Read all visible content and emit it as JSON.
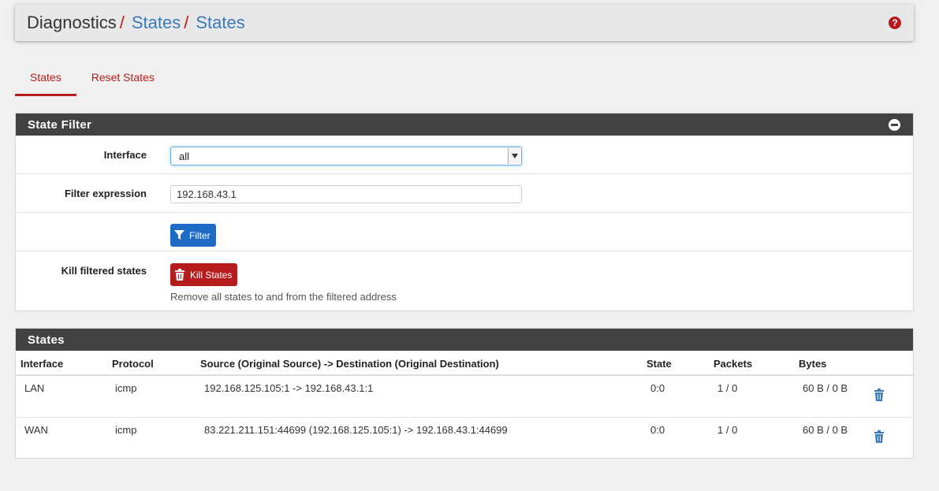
{
  "breadcrumb": {
    "root": "Diagnostics",
    "separator": "/",
    "items": [
      "States",
      "States"
    ]
  },
  "help_icon": "?",
  "tabs": [
    {
      "label": "States",
      "active": true
    },
    {
      "label": "Reset States",
      "active": false
    }
  ],
  "state_filter": {
    "title": "State Filter",
    "interface_label": "Interface",
    "interface_value": "all",
    "filter_expression_label": "Filter expression",
    "filter_expression_value": "192.168.43.1",
    "filter_button": "Filter",
    "kill_label": "Kill filtered states",
    "kill_button": "Kill States",
    "kill_help": "Remove all states to and from the filtered address"
  },
  "states": {
    "title": "States",
    "columns": [
      "Interface",
      "Protocol",
      "Source (Original Source) -> Destination (Original Destination)",
      "State",
      "Packets",
      "Bytes"
    ],
    "rows": [
      {
        "interface": "LAN",
        "protocol": "icmp",
        "source_dest": "192.168.125.105:1 -> 192.168.43.1:1",
        "state": "0:0",
        "packets": "1 / 0",
        "bytes": "60 B / 0 B"
      },
      {
        "interface": "WAN",
        "protocol": "icmp",
        "source_dest": "83.221.211.151:44699 (192.168.125.105:1) -> 192.168.43.1:44699",
        "state": "0:0",
        "packets": "1 / 0",
        "bytes": "60 B / 0 B"
      }
    ]
  },
  "colors": {
    "accent": "#b71c1c",
    "link": "#3a7bbf",
    "panel_heading": "#424242",
    "primary_button": "#1e6bc6"
  }
}
